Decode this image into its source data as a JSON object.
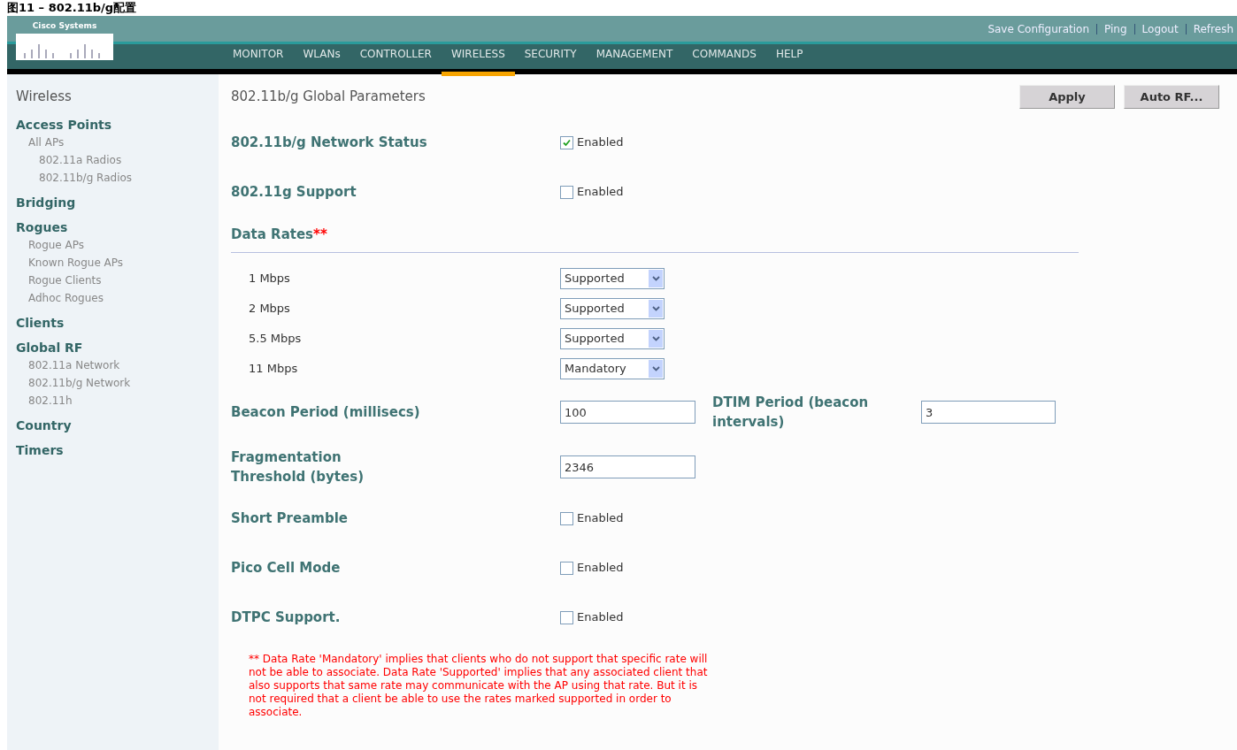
{
  "caption": "图11 – 802.11b/g配置",
  "logo": {
    "text": "Cisco Systems"
  },
  "top_links": [
    "Save Configuration",
    "Ping",
    "Logout",
    "Refresh"
  ],
  "nav": [
    {
      "label": "MONITOR",
      "selected": false
    },
    {
      "label": "WLANs",
      "selected": false
    },
    {
      "label": "CONTROLLER",
      "selected": false
    },
    {
      "label": "WIRELESS",
      "selected": true
    },
    {
      "label": "SECURITY",
      "selected": false
    },
    {
      "label": "MANAGEMENT",
      "selected": false
    },
    {
      "label": "COMMANDS",
      "selected": false
    },
    {
      "label": "HELP",
      "selected": false
    }
  ],
  "sidebar": {
    "title": "Wireless",
    "items": [
      {
        "label": "Access Points",
        "children": [
          {
            "label": "All APs",
            "children": [
              {
                "label": "802.11a Radios"
              },
              {
                "label": "802.11b/g Radios"
              }
            ]
          }
        ]
      },
      {
        "label": "Bridging"
      },
      {
        "label": "Rogues",
        "children": [
          {
            "label": "Rogue APs"
          },
          {
            "label": "Known Rogue APs"
          },
          {
            "label": "Rogue Clients"
          },
          {
            "label": "Adhoc Rogues"
          }
        ]
      },
      {
        "label": "Clients"
      },
      {
        "label": "Global RF",
        "children": [
          {
            "label": "802.11a Network"
          },
          {
            "label": "802.11b/g Network"
          },
          {
            "label": "802.11h"
          }
        ]
      },
      {
        "label": "Country"
      },
      {
        "label": "Timers"
      }
    ]
  },
  "page_title": "802.11b/g Global Parameters",
  "buttons": [
    "Apply",
    "Auto RF..."
  ],
  "fields": [
    {
      "kind": "checkbox",
      "label": "802.11b/g Network Status",
      "option": "Enabled",
      "checked": true
    },
    {
      "kind": "checkbox",
      "label": "802.11g Support",
      "option": "Enabled",
      "checked": false
    },
    {
      "kind": "section",
      "label": "Data Rates",
      "mark": "**"
    },
    {
      "kind": "select",
      "label": "1 Mbps",
      "value": "Supported"
    },
    {
      "kind": "select",
      "label": "2 Mbps",
      "value": "Supported"
    },
    {
      "kind": "select",
      "label": "5.5 Mbps",
      "value": "Supported"
    },
    {
      "kind": "select",
      "label": "11 Mbps",
      "value": "Mandatory"
    },
    {
      "kind": "input_pair",
      "label": "Beacon Period (millisecs)",
      "value": "100",
      "label2": "DTIM Period (beacon intervals)",
      "value2": "3"
    },
    {
      "kind": "input",
      "label": "Fragmentation Threshold (bytes)",
      "value": "2346"
    },
    {
      "kind": "checkbox",
      "label": "Short Preamble",
      "option": "Enabled",
      "checked": false
    },
    {
      "kind": "checkbox",
      "label": "Pico Cell Mode",
      "option": "Enabled",
      "checked": false
    },
    {
      "kind": "checkbox",
      "label": "DTPC Support.",
      "option": "Enabled",
      "checked": false
    }
  ],
  "note": "** Data Rate 'Mandatory' implies that clients who do not support that specific rate will not be able to associate. Data Rate 'Supported' implies that any associated client that also supports that same rate may communicate with the AP using that rate. But it is not required that a client be able to use the rates marked supported in order to associate."
}
